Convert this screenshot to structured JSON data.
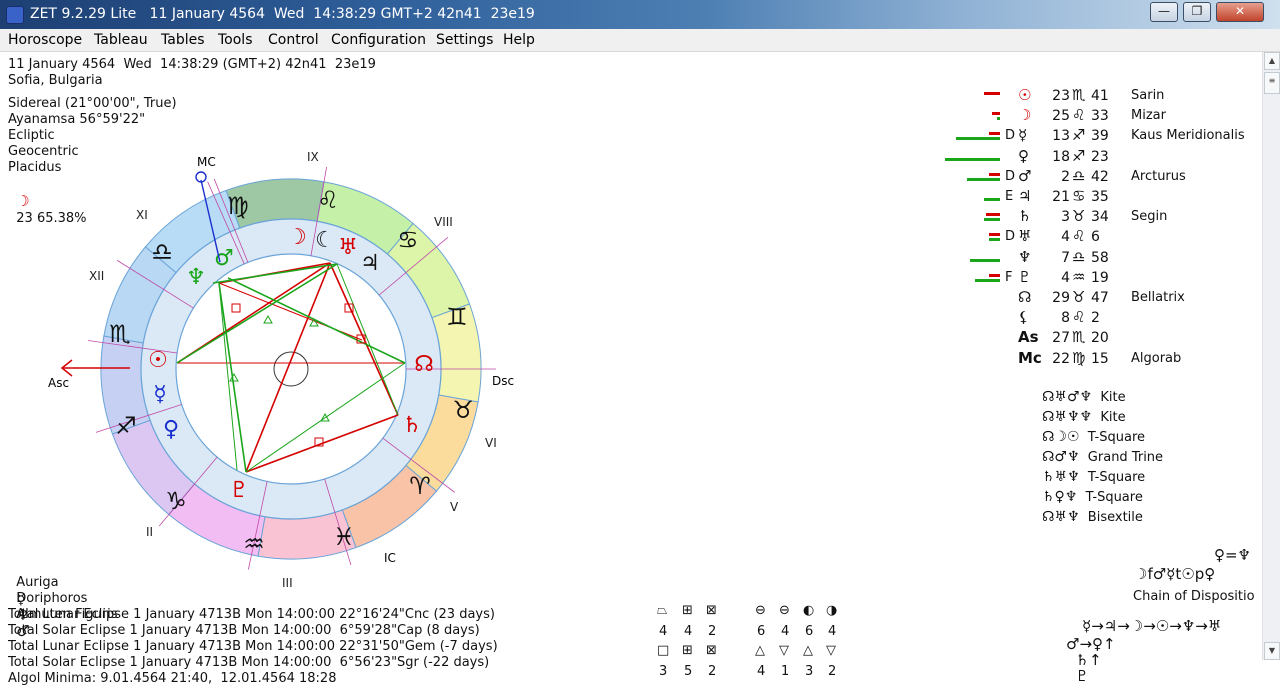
{
  "window": {
    "title": "ZET 9.2.29 Lite   11 January 4564  Wed  14:38:29 GMT+2 42n41  23e19",
    "minimize": "—",
    "maximize": "❐",
    "close": "✕"
  },
  "menu": [
    "Horoscope",
    "Tableau",
    "Tables",
    "Tools",
    "Control",
    "Configuration",
    "Settings",
    "Help"
  ],
  "info": {
    "date_line": "11 January 4564  Wed  14:38:29 (GMT+2) 42n41  23e19",
    "place": "Sofia, Bulgaria",
    "zodiac": "Sidereal (21°00'00\", True)",
    "ayanamsa": "Ayanamsa 56°59'22\"",
    "ecliptic": "Ecliptic",
    "geocentric": "Geocentric",
    "houses": "Placidus",
    "moon_phase": "23 65.38%"
  },
  "chart_wheel": {
    "angle_labels": {
      "mc": "MC",
      "asc": "Asc",
      "dsc": "Dsc",
      "ic": "IC"
    },
    "house_numerals": [
      "IX",
      "VIII",
      "XI",
      "XII",
      "VI",
      "V",
      "II",
      "III"
    ],
    "colors": {
      "aspect_red": "#d40000",
      "aspect_green": "#1aa51a",
      "inner_ring": "#dbe8f5",
      "outer_line": "#6aa4d8"
    }
  },
  "positions": [
    {
      "glyph": "☉",
      "deg": "23",
      "sign": "♏",
      "min": "41",
      "star": "Sarin",
      "mark": "",
      "color": "#d40000"
    },
    {
      "glyph": "☽",
      "deg": "25",
      "sign": "♌",
      "min": "33",
      "star": "Mizar",
      "mark": "",
      "color": "#d40000"
    },
    {
      "glyph": "☿",
      "deg": "13",
      "sign": "♐",
      "min": "39",
      "star": "Kaus Meridionalis",
      "mark": "D",
      "color": "#111"
    },
    {
      "glyph": "♀",
      "deg": "18",
      "sign": "♐",
      "min": "23",
      "star": "",
      "mark": "",
      "color": "#111"
    },
    {
      "glyph": "♂",
      "deg": "2",
      "sign": "♎",
      "min": "42",
      "star": "Arcturus",
      "mark": "D",
      "color": "#111"
    },
    {
      "glyph": "♃",
      "deg": "21",
      "sign": "♋",
      "min": "35",
      "star": "",
      "mark": "E",
      "color": "#111"
    },
    {
      "glyph": "♄",
      "deg": "3",
      "sign": "♉",
      "min": "34",
      "star": "Segin",
      "mark": "",
      "color": "#111"
    },
    {
      "glyph": "♅",
      "deg": "4",
      "sign": "♌",
      "min": "6",
      "star": "",
      "mark": "D",
      "color": "#111"
    },
    {
      "glyph": "♆",
      "deg": "7",
      "sign": "♎",
      "min": "58",
      "star": "",
      "mark": "",
      "color": "#111"
    },
    {
      "glyph": "♇",
      "deg": "4",
      "sign": "♒",
      "min": "19",
      "star": "",
      "mark": "F",
      "color": "#111"
    },
    {
      "glyph": "☊",
      "deg": "29",
      "sign": "♉",
      "min": "47",
      "star": "Bellatrix",
      "mark": "",
      "color": "#111"
    },
    {
      "glyph": "⚸",
      "deg": "8",
      "sign": "♌",
      "min": "2",
      "star": "",
      "mark": "",
      "color": "#111"
    },
    {
      "glyph": "As",
      "deg": "27",
      "sign": "♏",
      "min": "20",
      "star": "",
      "mark": "",
      "color": "#111"
    },
    {
      "glyph": "Mc",
      "deg": "22",
      "sign": "♍",
      "min": "15",
      "star": "Algorab",
      "mark": "",
      "color": "#111"
    }
  ],
  "bars": [
    {
      "red": 0.3,
      "green": 0.0
    },
    {
      "red": 0.15,
      "green": 0.05
    },
    {
      "red": 0.2,
      "green": 0.8
    },
    {
      "red": 0.0,
      "green": 1.0
    },
    {
      "red": 0.2,
      "green": 0.6
    },
    {
      "red": 0.0,
      "green": 0.3
    },
    {
      "red": 0.25,
      "green": 0.3
    },
    {
      "red": 0.2,
      "green": 0.2
    },
    {
      "red": 0.0,
      "green": 0.55
    },
    {
      "red": 0.2,
      "green": 0.45
    }
  ],
  "patterns": [
    {
      "glyphs": "☊♅♂♆",
      "name": "Kite"
    },
    {
      "glyphs": "☊♅♆♆",
      "name": "Kite"
    },
    {
      "glyphs": "☊☽☉",
      "name": "T-Square"
    },
    {
      "glyphs": "☊♂♆",
      "name": "Grand Trine"
    },
    {
      "glyphs": "♄♅♆",
      "name": "T-Square"
    },
    {
      "glyphs": "♄♀♆",
      "name": "T-Square"
    },
    {
      "glyphs": "☊♅♆",
      "name": "Bisextile"
    }
  ],
  "disposition": {
    "top": "♀=♆",
    "row2": "☽f♂☿t☉p♀",
    "label": "Chain of Dispositio",
    "chain": "☿→♃→☽→☉→♆→♅"
  },
  "rulers": [
    {
      "name": "Auriga",
      "glyph": "☿"
    },
    {
      "name": "Doriphoros",
      "glyph": "♆"
    },
    {
      "name": "Almuten Figuris",
      "glyph": "♂"
    }
  ],
  "eclipses": [
    "Total Lunar Eclipse 1 January 4713B Mon 14:00:00 22°16'24\"Cnc (23 days)",
    "Total Solar Eclipse 1 January 4713B Mon 14:00:00  6°59'28\"Cap (8 days)",
    "Total Lunar Eclipse 1 January 4713B Mon 14:00:00 22°31'50\"Gem (-7 days)",
    "Total Solar Eclipse 1 January 4713B Mon 14:00:00  6°56'23\"Sgr (-22 days)",
    "Algol Minima: 9.01.4564 21:40,  12.01.4564 18:28"
  ],
  "stats": {
    "row1_symbols": [
      "⏢",
      "⊞",
      "⊠",
      "⊖",
      "⊖",
      "◐",
      "◑"
    ],
    "row1_values": [
      "4",
      "4",
      "2",
      "6",
      "4",
      "6",
      "4"
    ],
    "row2_symbols": [
      "□",
      "⊞",
      "⊠",
      "△",
      "▽",
      "△",
      "▽"
    ],
    "row2_values": [
      "3",
      "5",
      "2",
      "4",
      "1",
      "3",
      "2"
    ]
  }
}
